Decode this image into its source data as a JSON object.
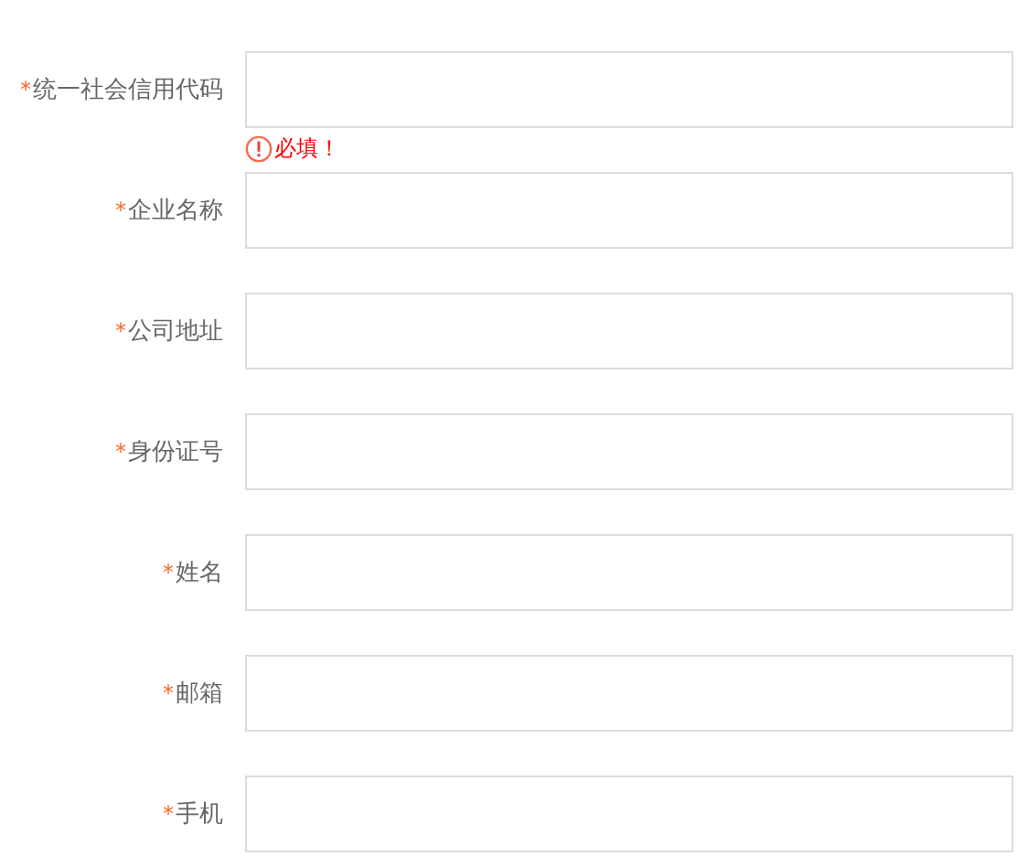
{
  "fields": [
    {
      "mark": "*",
      "label": "统一社会信用代码",
      "error": "必填！"
    },
    {
      "mark": "*",
      "label": "企业名称"
    },
    {
      "mark": "*",
      "label": "公司地址"
    },
    {
      "mark": "*",
      "label": "身份证号"
    },
    {
      "mark": "*",
      "label": "姓名"
    },
    {
      "mark": "*",
      "label": "邮箱"
    },
    {
      "mark": "*",
      "label": "手机"
    }
  ]
}
